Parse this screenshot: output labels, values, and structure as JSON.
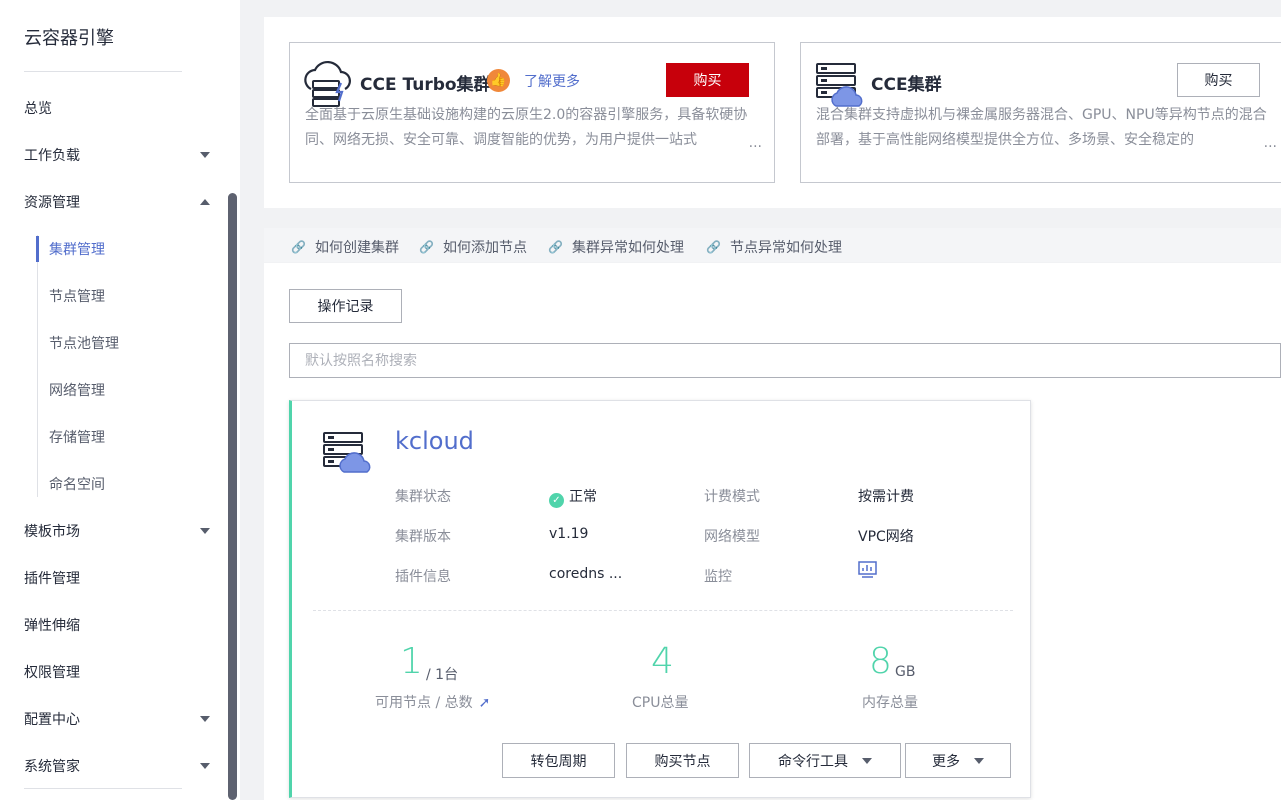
{
  "sidebar": {
    "title": "云容器引擎",
    "items": [
      {
        "label": "总览"
      },
      {
        "label": "工作负载"
      },
      {
        "label": "资源管理"
      },
      {
        "label": "模板市场"
      },
      {
        "label": "插件管理"
      },
      {
        "label": "弹性伸缩"
      },
      {
        "label": "权限管理"
      },
      {
        "label": "配置中心"
      },
      {
        "label": "系统管家"
      }
    ],
    "sub_items": [
      {
        "label": "集群管理"
      },
      {
        "label": "节点管理"
      },
      {
        "label": "节点池管理"
      },
      {
        "label": "网络管理"
      },
      {
        "label": "存储管理"
      },
      {
        "label": "命名空间"
      }
    ]
  },
  "promo": {
    "turbo": {
      "title": "CCE Turbo集群",
      "learn_more": "了解更多",
      "buy": "购买",
      "desc": "全面基于云原生基础设施构建的云原生2.0的容器引擎服务，具备软硬协同、网络无损、安全可靠、调度智能的优势，为用户提供一站式",
      "ellipsis": "..."
    },
    "cce": {
      "title": "CCE集群",
      "buy": "购买",
      "desc": "混合集群支持虚拟机与裸金属服务器混合、GPU、NPU等异构节点的混合部署，基于高性能网络模型提供全方位、多场景、安全稳定的",
      "ellipsis": "..."
    }
  },
  "help_links": [
    "如何创建集群",
    "如何添加节点",
    "集群异常如何处理",
    "节点异常如何处理"
  ],
  "toolbar": {
    "op_record": "操作记录",
    "search_placeholder": "默认按照名称搜索"
  },
  "cluster": {
    "name": "kcloud",
    "fields": {
      "status_label": "集群状态",
      "status_value": "正常",
      "billing_label": "计费模式",
      "billing_value": "按需计费",
      "version_label": "集群版本",
      "version_value": "v1.19",
      "network_label": "网络模型",
      "network_value": "VPC网络",
      "addon_label": "插件信息",
      "addon_value": "coredns ...",
      "monitor_label": "监控"
    },
    "stats": {
      "nodes_available": "1",
      "nodes_total": "/ 1台",
      "nodes_label": "可用节点 / 总数",
      "cpu_value": "4",
      "cpu_label": "CPU总量",
      "mem_value": "8",
      "mem_unit": "GB",
      "mem_label": "内存总量"
    },
    "buttons": {
      "renew": "转包周期",
      "buy_node": "购买节点",
      "cli": "命令行工具",
      "more": "更多"
    }
  },
  "colors": {
    "accent": "#526ecc",
    "success": "#50d4ab",
    "buy_red": "#c7000b",
    "orange": "#f0883a"
  }
}
